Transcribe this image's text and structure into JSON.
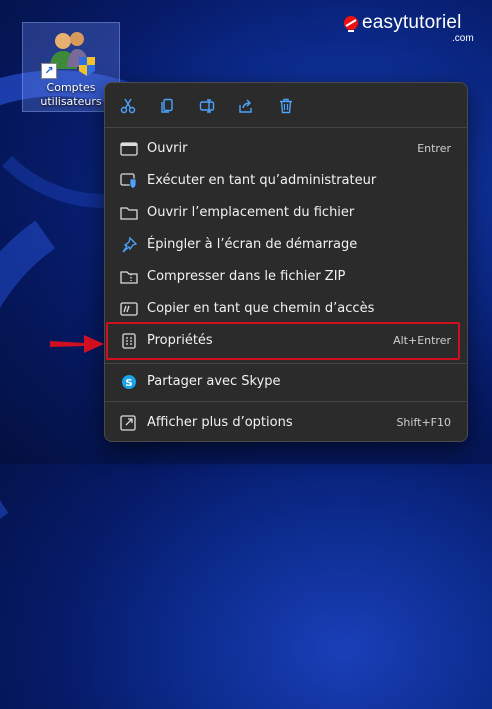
{
  "desktop": {
    "icon_label": "Comptes utilisateurs"
  },
  "watermark": {
    "name": "easytutoriel",
    "tld": ".com"
  },
  "context_menu": {
    "toolbar": [
      {
        "icon": "cut-icon"
      },
      {
        "icon": "copy-icon"
      },
      {
        "icon": "rename-icon"
      },
      {
        "icon": "share-icon"
      },
      {
        "icon": "delete-icon"
      }
    ],
    "items": [
      {
        "label": "Ouvrir",
        "shortcut": "Entrer",
        "icon": "open-window-icon"
      },
      {
        "label": "Exécuter en tant qu’administrateur",
        "shortcut": "",
        "icon": "shield-icon"
      },
      {
        "label": "Ouvrir l’emplacement du fichier",
        "shortcut": "",
        "icon": "folder-icon"
      },
      {
        "label": "Épingler à l’écran de démarrage",
        "shortcut": "",
        "icon": "pin-icon"
      },
      {
        "label": "Compresser dans le fichier ZIP",
        "shortcut": "",
        "icon": "zip-folder-icon"
      },
      {
        "label": "Copier en tant que chemin d’accès",
        "shortcut": "",
        "icon": "copy-path-icon"
      },
      {
        "label": "Propriétés",
        "shortcut": "Alt+Entrer",
        "icon": "properties-icon"
      },
      {
        "label": "Partager avec Skype",
        "shortcut": "",
        "icon": "skype-icon"
      },
      {
        "label": "Afficher plus d’options",
        "shortcut": "Shift+F10",
        "icon": "more-options-icon"
      }
    ]
  },
  "colors": {
    "menu_bg": "#2b2b2b",
    "accent_icon": "#4aa3ff",
    "highlight": "#d01020",
    "skype": "#1aa3e8"
  }
}
